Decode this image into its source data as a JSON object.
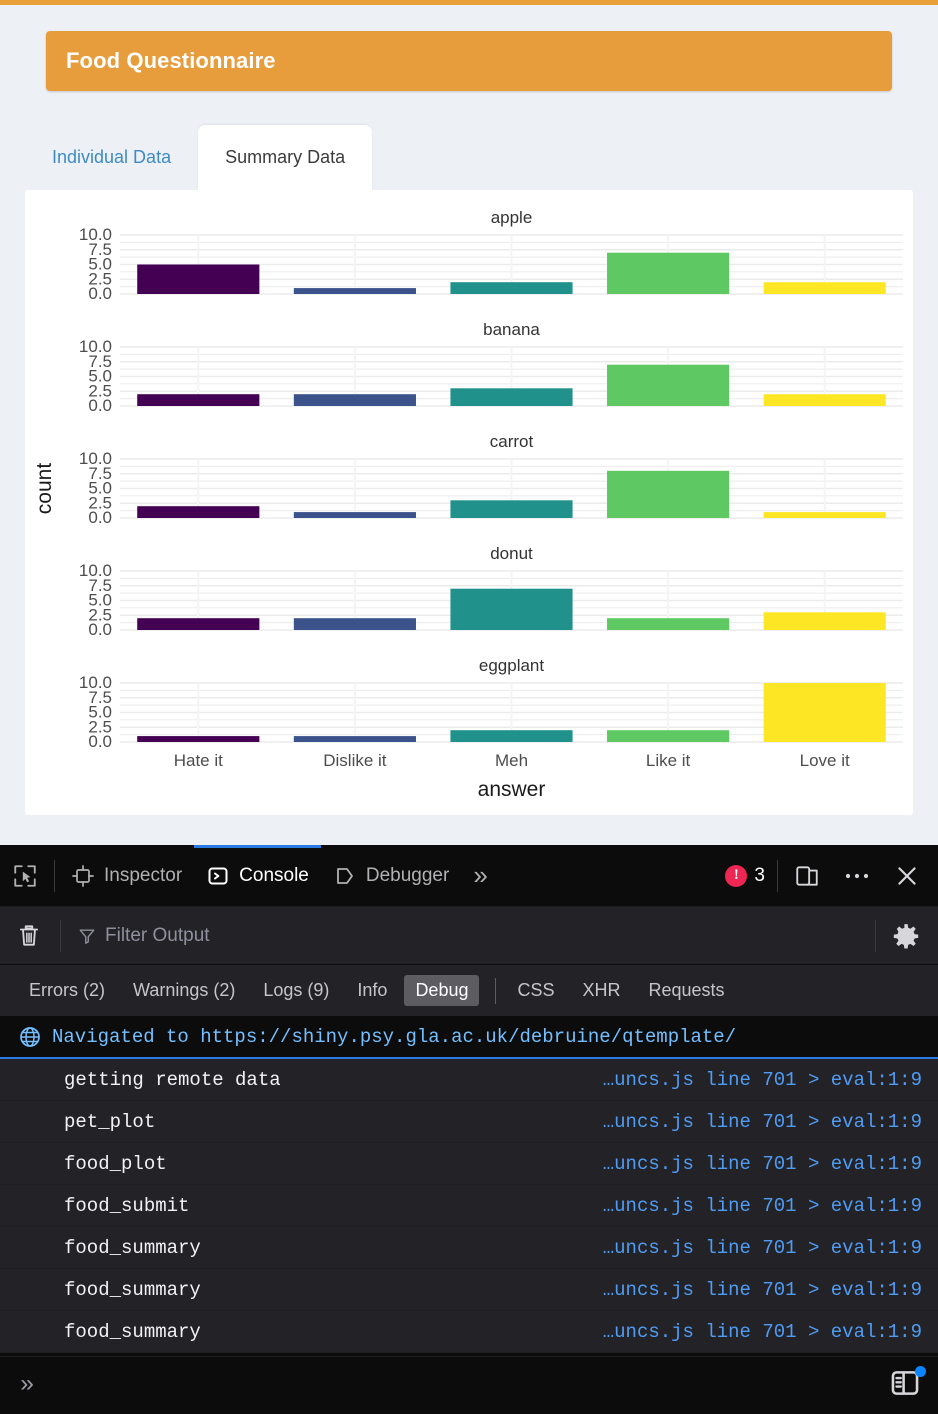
{
  "app": {
    "header_title": "Food Questionnaire",
    "header_color": "#e79d3c",
    "tabs": [
      {
        "label": "Individual Data",
        "active": false
      },
      {
        "label": "Summary Data",
        "active": true
      }
    ]
  },
  "chart_data": {
    "type": "bar",
    "title": "",
    "xlabel": "answer",
    "ylabel": "count",
    "ylim": [
      0,
      10
    ],
    "yticks": [
      "0.0",
      "2.5",
      "5.0",
      "7.5",
      "10.0"
    ],
    "grid": true,
    "legend": "none",
    "facet_titles": [
      "apple",
      "banana",
      "carrot",
      "donut",
      "eggplant"
    ],
    "categories": [
      "Hate it",
      "Dislike it",
      "Meh",
      "Like it",
      "Love it"
    ],
    "bar_colors": [
      "#440154",
      "#3B528B",
      "#21918C",
      "#5EC962",
      "#FDE725"
    ],
    "facets": [
      {
        "name": "apple",
        "values": [
          5,
          1,
          2,
          7,
          2
        ]
      },
      {
        "name": "banana",
        "values": [
          2,
          2,
          3,
          7,
          2
        ]
      },
      {
        "name": "carrot",
        "values": [
          2,
          1,
          3,
          8,
          1
        ]
      },
      {
        "name": "donut",
        "values": [
          2,
          2,
          7,
          2,
          3
        ]
      },
      {
        "name": "eggplant",
        "values": [
          1,
          1,
          2,
          2,
          10
        ]
      }
    ]
  },
  "devtools": {
    "toolbar": {
      "picker_icon": "element-picker-icon",
      "tabs": [
        {
          "label": "Inspector",
          "icon": "inspector-icon",
          "active": false
        },
        {
          "label": "Console",
          "icon": "console-icon",
          "active": true
        },
        {
          "label": "Debugger",
          "icon": "debugger-icon",
          "active": false
        }
      ],
      "overflow_label": "»",
      "error_count": "3",
      "responsive_icon": "responsive-design-mode-icon",
      "meatball_icon": "more-options-icon",
      "close_icon": "close-icon"
    },
    "filterbar": {
      "trash_icon": "clear-console-icon",
      "filter_icon": "filter-icon",
      "filter_placeholder": "Filter Output",
      "settings_icon": "console-settings-icon"
    },
    "filters": [
      {
        "label": "Errors (2)",
        "on": false
      },
      {
        "label": "Warnings (2)",
        "on": false
      },
      {
        "label": "Logs (9)",
        "on": false
      },
      {
        "label": "Info",
        "on": false
      },
      {
        "label": "Debug",
        "on": true
      },
      {
        "label": "CSS",
        "on": false
      },
      {
        "label": "XHR",
        "on": false
      },
      {
        "label": "Requests",
        "on": false
      }
    ],
    "navigation": {
      "icon": "globe-icon",
      "text": "Navigated to https://shiny.psy.gla.ac.uk/debruine/qtemplate/"
    },
    "logs": [
      {
        "message": "getting remote data",
        "source": "…uncs.js line 701 > eval:1:9"
      },
      {
        "message": "pet_plot",
        "source": "…uncs.js line 701 > eval:1:9"
      },
      {
        "message": "food_plot",
        "source": "…uncs.js line 701 > eval:1:9"
      },
      {
        "message": "food_submit",
        "source": "…uncs.js line 701 > eval:1:9"
      },
      {
        "message": "food_summary",
        "source": "…uncs.js line 701 > eval:1:9"
      },
      {
        "message": "food_summary",
        "source": "…uncs.js line 701 > eval:1:9"
      },
      {
        "message": "food_summary",
        "source": "…uncs.js line 701 > eval:1:9"
      }
    ],
    "input": {
      "prompt": "»",
      "value": "",
      "split_console_icon": "split-console-icon"
    }
  }
}
